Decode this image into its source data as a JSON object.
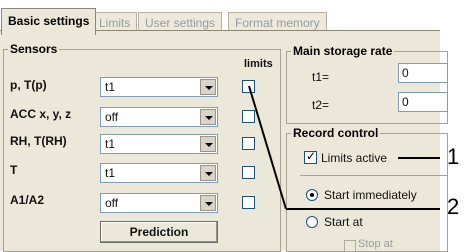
{
  "tabs": [
    {
      "label": "Basic settings",
      "active": true
    },
    {
      "label": "Limits",
      "active": false
    },
    {
      "label": "User settings",
      "active": false
    },
    {
      "label": "Format memory",
      "active": false
    }
  ],
  "sensors": {
    "title": "Sensors",
    "limits_header": "limits",
    "rows": [
      {
        "label": "p, T(p)",
        "value": "t1",
        "limit_checked": false
      },
      {
        "label": "ACC x, y, z",
        "value": "off",
        "limit_checked": false
      },
      {
        "label": "RH, T(RH)",
        "value": "t1",
        "limit_checked": false
      },
      {
        "label": "T",
        "value": "t1",
        "limit_checked": false
      },
      {
        "label": "A1/A2",
        "value": "off",
        "limit_checked": false
      }
    ],
    "prediction_button": "Prediction"
  },
  "storage": {
    "title": "Main storage rate",
    "t1_label": "t1=",
    "t1_value": "0",
    "t2_label": "t2=",
    "t2_value": "0"
  },
  "record": {
    "title": "Record control",
    "limits_active_label": "Limits active",
    "limits_active_checked": true,
    "start_immediately_label": "Start immediately",
    "start_at_label": "Start at",
    "selected": "start_immediately",
    "partial_label": "Stop at"
  },
  "callouts": [
    "1",
    "2"
  ]
}
